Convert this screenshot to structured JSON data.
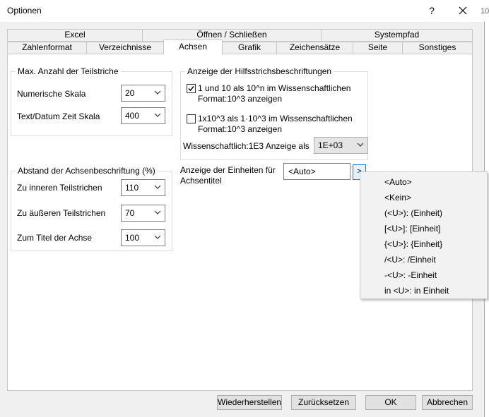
{
  "window": {
    "title": "Optionen",
    "help": "?",
    "outside_text": "10"
  },
  "tabs": {
    "row1": [
      "Excel",
      "Öffnen / Schließen",
      "Systempfad"
    ],
    "row2": [
      "Zahlenformat",
      "Verzeichnisse",
      "Achsen",
      "Grafik",
      "Zeichensätze",
      "Seite",
      "Sonstiges"
    ],
    "active": "Achsen"
  },
  "max_ticks": {
    "title": "Max. Anzahl der Teilstriche",
    "numeric_label": "Numerische Skala",
    "numeric_value": "20",
    "text_label": "Text/Datum Zeit Skala",
    "text_value": "400"
  },
  "axis_distance": {
    "title": "Abstand der Achsenbeschriftung (%)",
    "inner_label": "Zu inneren Teilstrichen",
    "inner_value": "110",
    "outer_label": "Zu äußeren Teilstrichen",
    "outer_value": "70",
    "title_label": "Zum Titel der Achse",
    "title_value": "100"
  },
  "helper_labels": {
    "title": "Anzeige der Hilfsstrichsbeschriftungen",
    "check1_line1": "1 und 10 als 10^n im Wissenschaftlichen",
    "check1_line2": "Format:10^3 anzeigen",
    "check1_checked": true,
    "check2_line1": "1x10^3 als 1·10^3 im Wissenschaftlichen",
    "check2_line2": "Format:10^3 anzeigen",
    "check2_checked": false,
    "sci_label": "Wissenschaftlich:1E3 Anzeige als",
    "sci_value": "1E+03"
  },
  "units": {
    "label_line1": "Anzeige der Einheiten für",
    "label_line2": "Achsentitel",
    "value": "<Auto>",
    "button": ">"
  },
  "popup_items": [
    "<Auto>",
    "<Kein>",
    "(<U>): (Einheit)",
    "[<U>]: [Einheit]",
    "{<U>}: {Einheit}",
    "/<U>: /Einheit",
    "-<U>: -Einheit",
    "in <U>: in Einheit"
  ],
  "buttons": {
    "restore": "Wiederherstellen",
    "reset": "Zurücksetzen",
    "ok": "OK",
    "cancel": "Abbrechen"
  }
}
